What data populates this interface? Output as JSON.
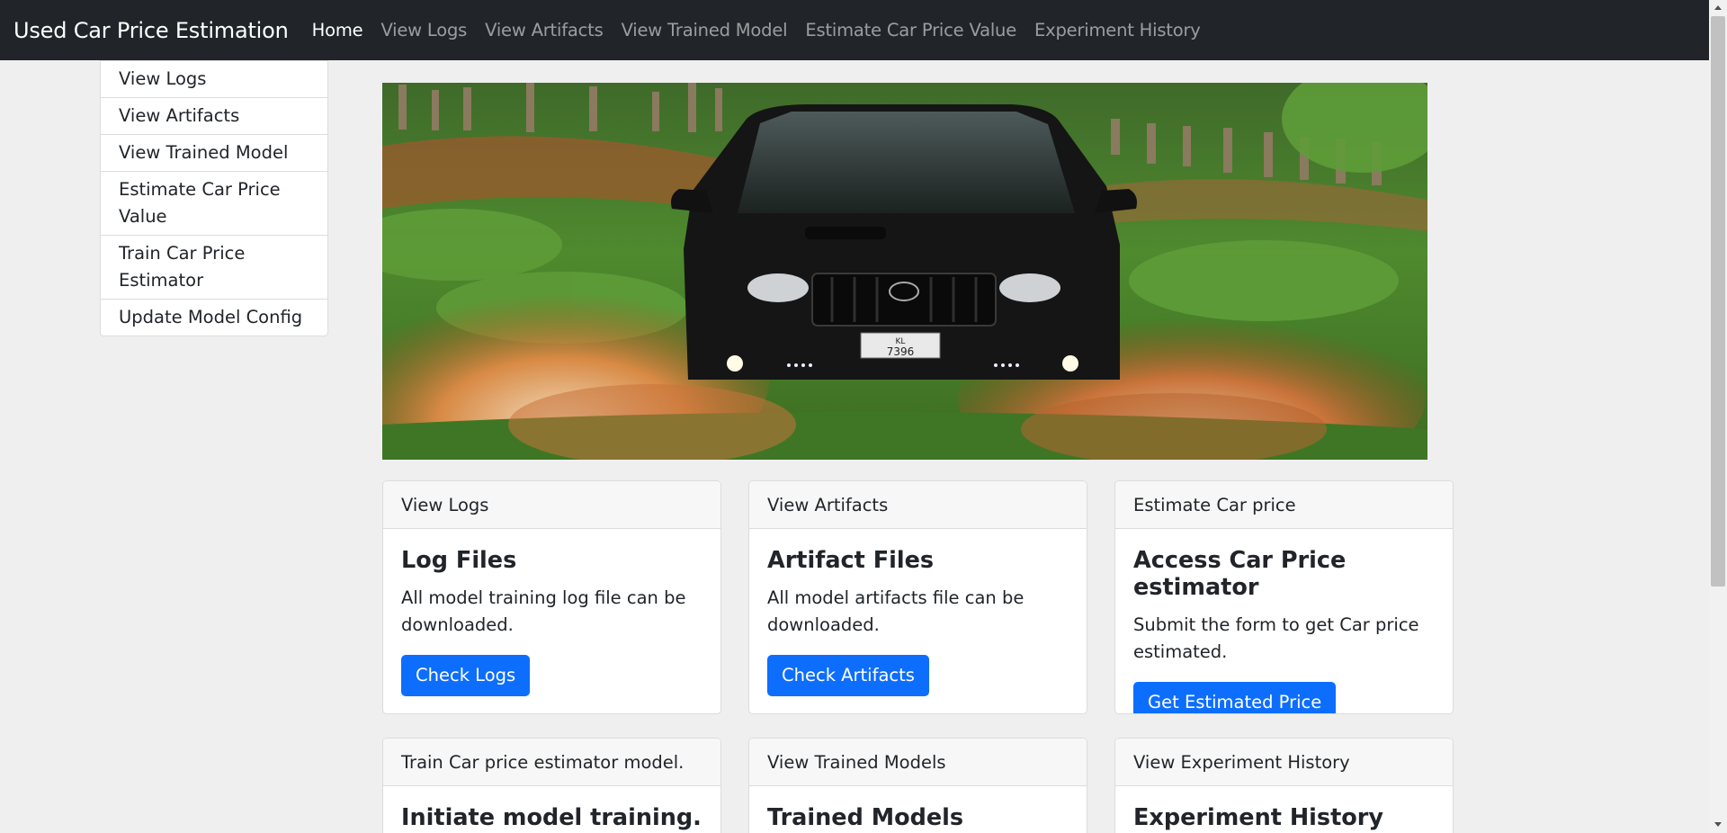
{
  "navbar": {
    "brand": "Used Car Price Estimation",
    "links": [
      {
        "label": "Home",
        "active": true
      },
      {
        "label": "View Logs"
      },
      {
        "label": "View Artifacts"
      },
      {
        "label": "View Trained Model"
      },
      {
        "label": "Estimate Car Price Value"
      },
      {
        "label": "Experiment History"
      }
    ]
  },
  "sidebar": {
    "items": [
      {
        "label": "View Logs"
      },
      {
        "label": "View Artifacts"
      },
      {
        "label": "View Trained Model"
      },
      {
        "label": "Estimate Car Price Value"
      },
      {
        "label": "Train Car Price Estimator"
      },
      {
        "label": "Update Model Config"
      }
    ]
  },
  "hero": {
    "plate_line1": "KL",
    "plate_line2": "7396"
  },
  "cards": [
    {
      "header": "View Logs",
      "title": "Log Files",
      "text": "All model training log file can be downloaded.",
      "button": "Check Logs"
    },
    {
      "header": "View Artifacts",
      "title": "Artifact Files",
      "text": "All model artifacts file can be downloaded.",
      "button": "Check Artifacts"
    },
    {
      "header": "Estimate Car price",
      "title": "Access Car Price estimator",
      "text": "Submit the form to get Car price estimated.",
      "button": "Get Estimated Price"
    },
    {
      "header": "Train Car price estimator model.",
      "title": "Initiate model training."
    },
    {
      "header": "View Trained Models",
      "title": "Trained Models"
    },
    {
      "header": "View Experiment History",
      "title": "Experiment History"
    }
  ],
  "colors": {
    "navbar_bg": "#212529",
    "primary_button": "#0d6efd",
    "page_bg": "#efefef"
  }
}
